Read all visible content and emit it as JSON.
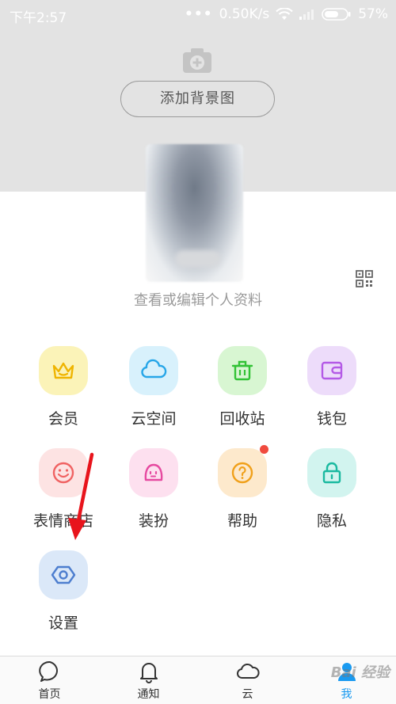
{
  "status_bar": {
    "time": "下午2:57",
    "speed": "0.50K/s",
    "battery": "57%"
  },
  "cover": {
    "add_background_label": "添加背景图"
  },
  "profile": {
    "edit_link": "查看或编辑个人资料"
  },
  "grid": {
    "items": [
      {
        "label": "会员"
      },
      {
        "label": "云空间"
      },
      {
        "label": "回收站"
      },
      {
        "label": "钱包"
      },
      {
        "label": "表情商店"
      },
      {
        "label": "装扮"
      },
      {
        "label": "帮助"
      },
      {
        "label": "隐私"
      },
      {
        "label": "设置"
      }
    ]
  },
  "tabs": [
    {
      "label": "首页"
    },
    {
      "label": "通知"
    },
    {
      "label": "云"
    },
    {
      "label": "我"
    }
  ],
  "watermark": "Bai 经验",
  "colors": {
    "active_tab": "#1a9af0",
    "red_dot": "#f04a3e",
    "arrow": "#e8141c"
  }
}
